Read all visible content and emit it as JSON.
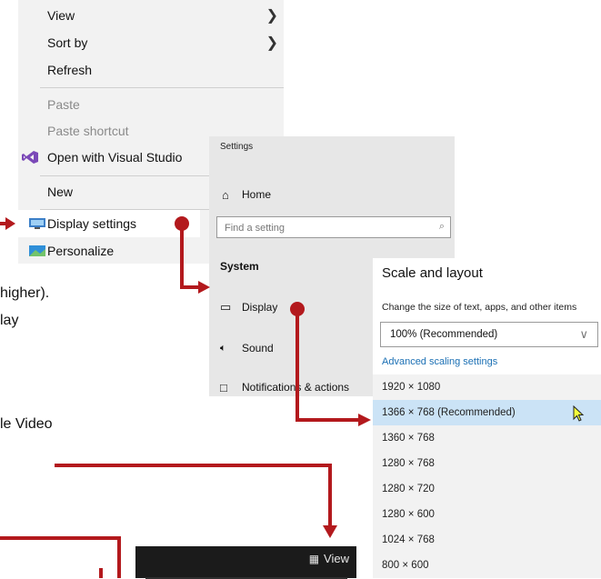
{
  "context_menu": {
    "items": [
      {
        "label": "View",
        "has_submenu": true,
        "disabled": false
      },
      {
        "label": "Sort by",
        "has_submenu": true,
        "disabled": false
      },
      {
        "label": "Refresh",
        "disabled": false
      },
      {
        "label": "Paste",
        "disabled": true
      },
      {
        "label": "Paste shortcut",
        "disabled": true
      },
      {
        "label": "Open with Visual Studio",
        "icon": "visual-studio-icon",
        "disabled": false
      },
      {
        "label": "New",
        "has_submenu": true,
        "disabled": false
      },
      {
        "label": "Display settings",
        "icon": "display-icon",
        "disabled": false
      },
      {
        "label": "Personalize",
        "icon": "personalize-icon",
        "disabled": false
      }
    ]
  },
  "background_text": {
    "line1": "higher).",
    "line2": "lay",
    "line3": "le Video"
  },
  "settings": {
    "title": "Settings",
    "home_label": "Home",
    "search_placeholder": "Find a setting",
    "section_label": "System",
    "nav": [
      {
        "label": "Display",
        "icon": "monitor-icon"
      },
      {
        "label": "Sound",
        "icon": "speaker-icon"
      },
      {
        "label": "Notifications & actions",
        "icon": "notification-icon"
      }
    ]
  },
  "scale_layout": {
    "heading": "Scale and layout",
    "description": "Change the size of text, apps, and other items",
    "dropdown_value": "100% (Recommended)",
    "advanced_link": "Advanced scaling settings",
    "resolutions": [
      {
        "label": "1920 × 1080",
        "selected": false
      },
      {
        "label": "1366 × 768 (Recommended)",
        "selected": true
      },
      {
        "label": "1360 × 768",
        "selected": false
      },
      {
        "label": "1280 × 768",
        "selected": false
      },
      {
        "label": "1280 × 720",
        "selected": false
      },
      {
        "label": "1280 × 600",
        "selected": false
      },
      {
        "label": "1024 × 768",
        "selected": false
      },
      {
        "label": "800 × 600",
        "selected": false
      }
    ]
  },
  "view_bar": {
    "view_label": "View",
    "icon": "grid-icon"
  },
  "colors": {
    "connector": "#b3191d",
    "selection": "#cbe3f6",
    "link": "#1a6fb4"
  }
}
